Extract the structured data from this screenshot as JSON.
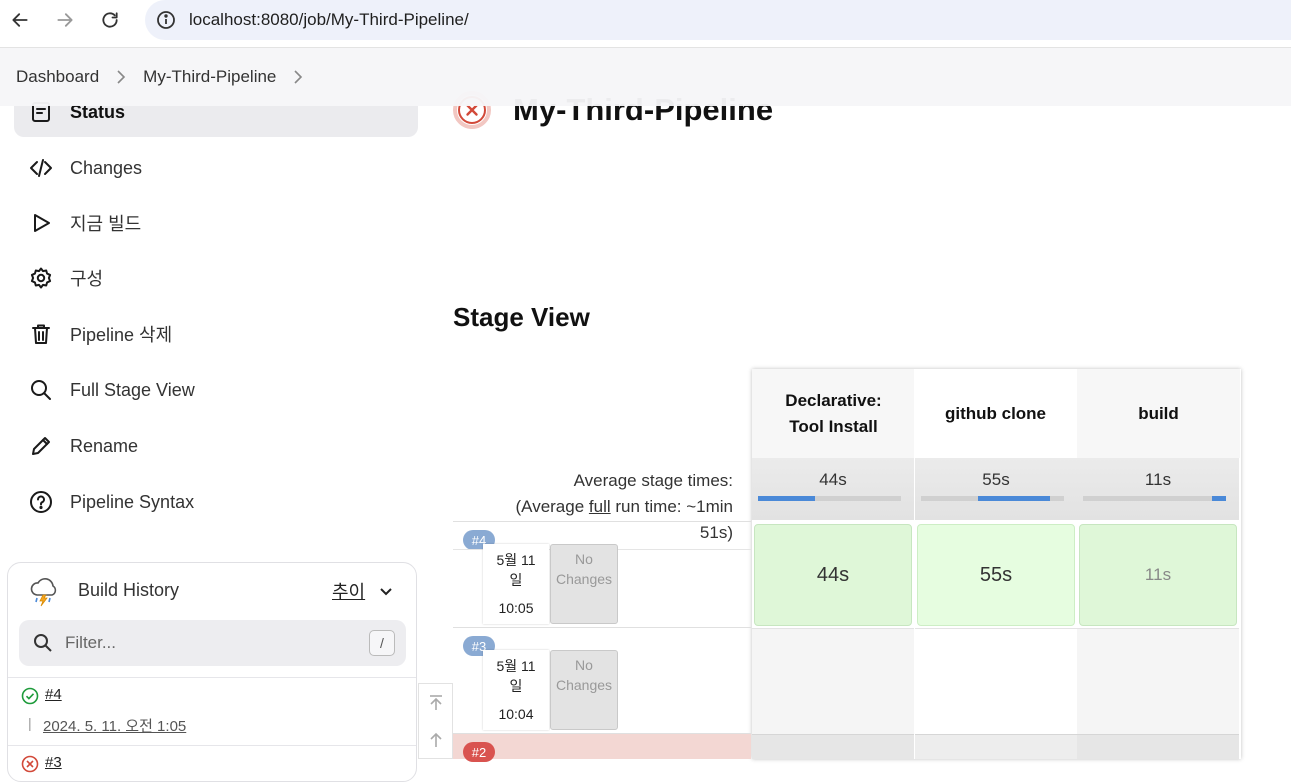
{
  "browser": {
    "url": "localhost:8080/job/My-Third-Pipeline/"
  },
  "breadcrumb": {
    "items": [
      "Dashboard",
      "My-Third-Pipeline"
    ]
  },
  "sidebar": {
    "items": [
      {
        "label": "Status",
        "icon": "status-icon",
        "active": true
      },
      {
        "label": "Changes",
        "icon": "code-icon"
      },
      {
        "label": "지금 빌드",
        "icon": "play-icon"
      },
      {
        "label": "구성",
        "icon": "gear-icon"
      },
      {
        "label": "Pipeline 삭제",
        "icon": "trash-icon"
      },
      {
        "label": "Full Stage View",
        "icon": "search-icon"
      },
      {
        "label": "Rename",
        "icon": "pencil-icon"
      },
      {
        "label": "Pipeline Syntax",
        "icon": "help-icon"
      }
    ]
  },
  "build_history": {
    "title": "Build History",
    "trend_label": "추이",
    "filter_placeholder": "Filter...",
    "shortcut": "/",
    "builds": [
      {
        "number": "#4",
        "date": "2024. 5. 11. 오전 1:05",
        "status": "success"
      },
      {
        "number": "#3",
        "date": "",
        "status": "failed"
      }
    ]
  },
  "job": {
    "title": "My-Third-Pipeline",
    "status": "failed"
  },
  "stage_view": {
    "heading": "Stage View",
    "avg_label_line1": "Average stage times:",
    "avg_label_prefix": "(Average ",
    "avg_label_link": "full",
    "avg_label_suffix": " run time: ~1min",
    "avg_label_line3": "51s)",
    "stages": [
      {
        "name_line1": "Declarative:",
        "name_line2": "Tool Install",
        "avg": "44s",
        "bar_start": 0.0,
        "bar_fraction": 0.4
      },
      {
        "name_line1": "github clone",
        "name_line2": "",
        "avg": "55s",
        "bar_start": 0.4,
        "bar_fraction": 0.5
      },
      {
        "name_line1": "build",
        "name_line2": "",
        "avg": "11s",
        "bar_start": 0.9,
        "bar_fraction": 0.1
      }
    ],
    "runs": [
      {
        "badge": "#4",
        "date": "5월 11",
        "day": "일",
        "time": "10:05",
        "changes": "No Changes",
        "cells": [
          "44s",
          "55s",
          "11s"
        ],
        "status": "success"
      },
      {
        "badge": "#3",
        "date": "5월 11",
        "day": "일",
        "time": "10:04",
        "changes": "No Changes",
        "cells": [
          "",
          "",
          ""
        ],
        "status": "unknown"
      },
      {
        "badge": "#2",
        "date": "",
        "day": "",
        "time": "",
        "changes": "",
        "cells": [
          "",
          "",
          ""
        ],
        "status": "failed"
      }
    ]
  },
  "colors": {
    "success_cell": "#dff7d8",
    "success_cell_light": "#e6fde0",
    "badge_blue": "#8aaad3",
    "badge_red": "#d9534f",
    "failed_row": "#f3d7d3",
    "bar_blue": "#4a89d8"
  }
}
